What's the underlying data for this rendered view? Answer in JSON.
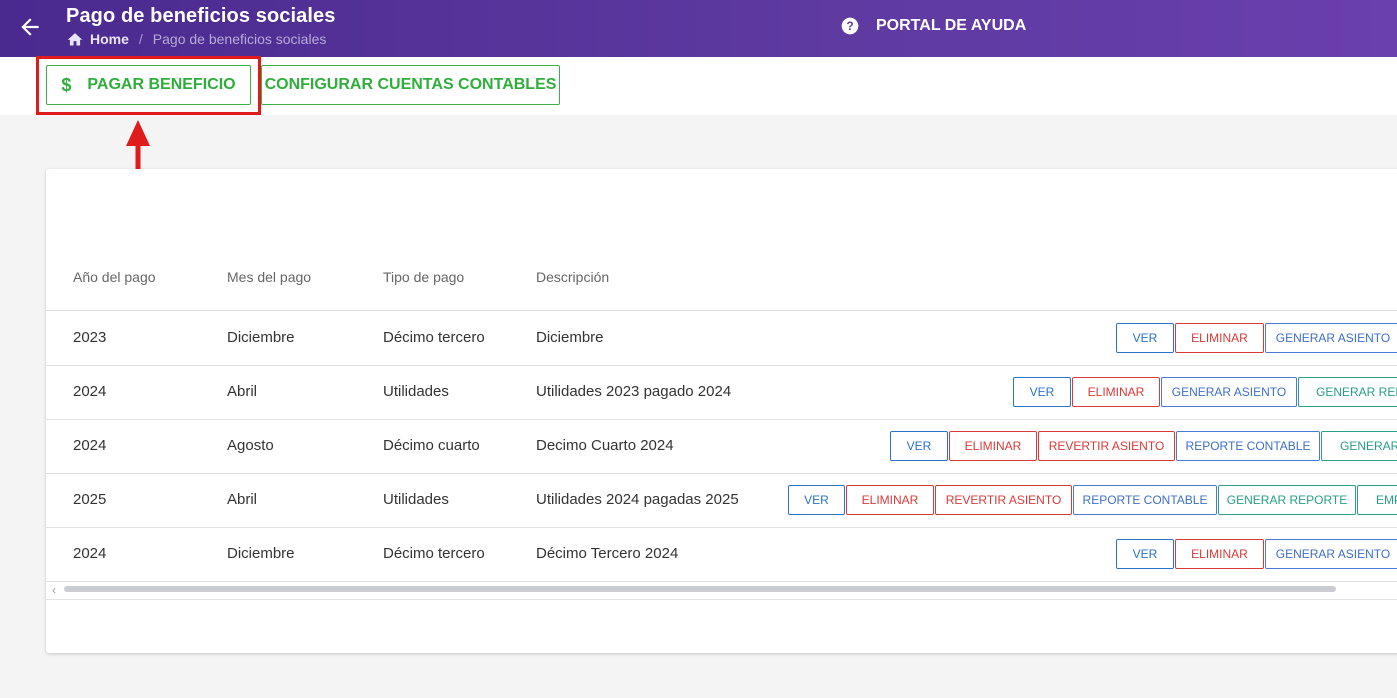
{
  "header": {
    "title": "Pago de beneficios sociales",
    "breadcrumb_home": "Home",
    "breadcrumb_current": "Pago de beneficios sociales",
    "help_label": "PORTAL DE AYUDA"
  },
  "toolbar": {
    "pay_label": "PAGAR BENEFICIO",
    "pay_icon": "$",
    "config_label": "CONFIGURAR CUENTAS CONTABLES"
  },
  "table": {
    "columns": [
      "Año del pago",
      "Mes del pago",
      "Tipo de pago",
      "Descripción"
    ],
    "rows": [
      {
        "year": "2023",
        "month": "Diciembre",
        "type": "Décimo tercero",
        "desc": "Diciembre",
        "actions": [
          "VER",
          "ELIMINAR",
          "GENERAR ASIENTO"
        ]
      },
      {
        "year": "2024",
        "month": "Abril",
        "type": "Utilidades",
        "desc": "Utilidades 2023 pagado 2024",
        "actions": [
          "VER",
          "ELIMINAR",
          "GENERAR ASIENTO",
          "GENERAR REPO"
        ]
      },
      {
        "year": "2024",
        "month": "Agosto",
        "type": "Décimo cuarto",
        "desc": "Decimo Cuarto 2024",
        "actions": [
          "VER",
          "ELIMINAR",
          "REVERTIR ASIENTO",
          "REPORTE CONTABLE",
          "GENERAR F"
        ]
      },
      {
        "year": "2025",
        "month": "Abril",
        "type": "Utilidades",
        "desc": "Utilidades 2024 pagadas 2025",
        "actions": [
          "VER",
          "ELIMINAR",
          "REVERTIR ASIENTO",
          "REPORTE CONTABLE",
          "GENERAR REPORTE",
          "EMP"
        ]
      },
      {
        "year": "2024",
        "month": "Diciembre",
        "type": "Décimo tercero",
        "desc": "Décimo Tercero 2024",
        "actions": [
          "VER",
          "ELIMINAR",
          "GENERAR ASIENTO"
        ]
      }
    ]
  },
  "colors": {
    "header_bg": "#5e3aa1",
    "accent_green": "#2fae3c",
    "highlight_red": "#e01b1b"
  }
}
